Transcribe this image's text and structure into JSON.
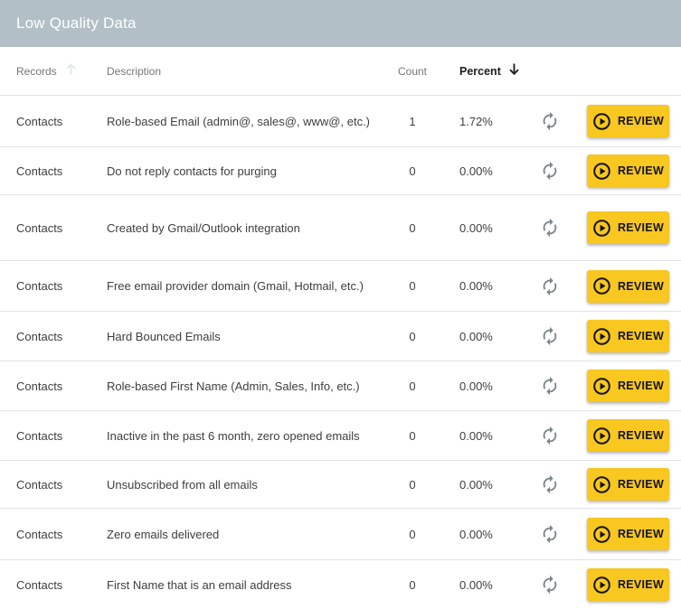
{
  "title": "Low Quality Data",
  "table": {
    "columns": {
      "records": "Records",
      "description": "Description",
      "count": "Count",
      "percent": "Percent"
    },
    "sort": {
      "column": "Percent",
      "direction": "descending"
    },
    "review_label": "REVIEW",
    "rows": [
      {
        "records": "Contacts",
        "description": "Role-based Email (admin@, sales@, www@, etc.)",
        "count": "1",
        "percent": "1.72%"
      },
      {
        "records": "Contacts",
        "description": "Do not reply contacts for purging",
        "count": "0",
        "percent": "0.00%"
      },
      {
        "records": "Contacts",
        "description": "Created by Gmail/Outlook integration",
        "count": "0",
        "percent": "0.00%"
      },
      {
        "records": "Contacts",
        "description": "Free email provider domain (Gmail, Hotmail, etc.)",
        "count": "0",
        "percent": "0.00%"
      },
      {
        "records": "Contacts",
        "description": "Hard Bounced Emails",
        "count": "0",
        "percent": "0.00%"
      },
      {
        "records": "Contacts",
        "description": "Role-based First Name (Admin, Sales, Info, etc.)",
        "count": "0",
        "percent": "0.00%"
      },
      {
        "records": "Contacts",
        "description": "Inactive in the past 6 month, zero opened emails",
        "count": "0",
        "percent": "0.00%"
      },
      {
        "records": "Contacts",
        "description": "Unsubscribed from all emails",
        "count": "0",
        "percent": "0.00%"
      },
      {
        "records": "Contacts",
        "description": "Zero emails delivered",
        "count": "0",
        "percent": "0.00%"
      },
      {
        "records": "Contacts",
        "description": "First Name that is an email address",
        "count": "0",
        "percent": "0.00%"
      }
    ]
  },
  "icons": {
    "sort_descending": "arrow-down-icon",
    "records_hover_sort": "arrow-up-icon",
    "row_refresh": "sync-icon",
    "review_play": "play-circle-icon"
  },
  "colors": {
    "header_bg": "#b2bfc6",
    "header_text": "#ffffff",
    "button_bg": "#f8c720",
    "button_text": "#141414",
    "muted_text": "#767676",
    "body_text": "#3e3e3e",
    "divider": "#e2e3e5",
    "icon_gray": "#7b868c"
  }
}
